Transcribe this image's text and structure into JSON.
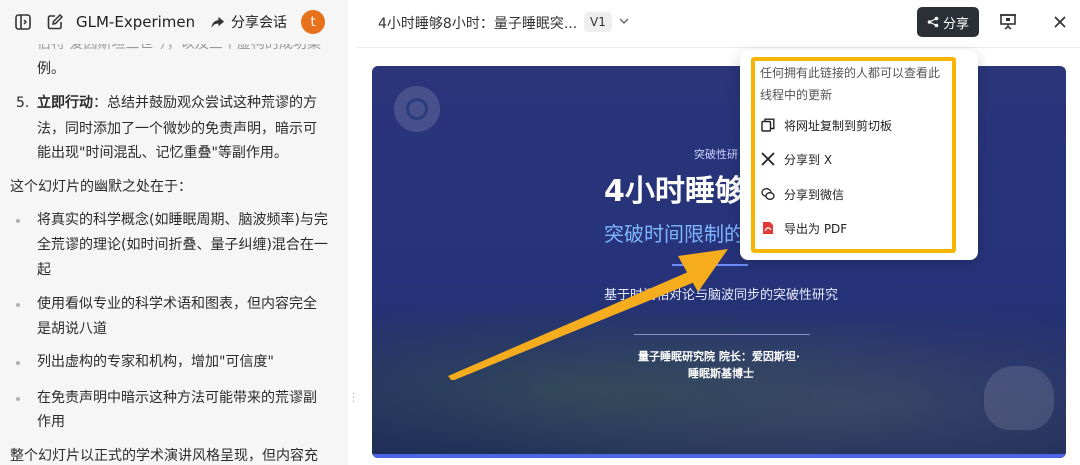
{
  "left_panel": {
    "title": "GLM-Experimen",
    "share_session_label": "分享会话",
    "avatar_letter": "t",
    "chat": {
      "top_faded_line": "伯特·爱因斯坦三世\"），以及三个虚构的成功案",
      "top_line_2": "例。",
      "item5_num": "5.",
      "item5_bold": "立即行动",
      "item5_line1_rest": "：总结并鼓励观众尝试这种荒谬的方",
      "item5_line2": "法，同时添加了一个微妙的免责声明，暗示可",
      "item5_line3": "能出现\"时间混乱、记忆重叠\"等副作用。",
      "humor_intro": "这个幻灯片的幽默之处在于：",
      "bullets": [
        {
          "line1": "将真实的科学概念(如睡眠周期、脑波频率)与完",
          "line2": "全荒谬的理论(如时间折叠、量子纠缠)混合在一",
          "line3": "起"
        },
        {
          "line1": "使用看似专业的科学术语和图表，但内容完全",
          "line2": "是胡说八道"
        },
        {
          "line1": "列出虚构的专家和机构，增加\"可信度\""
        },
        {
          "line1": "在免责声明中暗示这种方法可能带来的荒谬副",
          "line2": "作用"
        }
      ],
      "bottom_line": "整个幻灯片以正式的学术演讲风格呈现，但内容充"
    }
  },
  "topbar": {
    "doc_title": "4小时睡够8小时：量子睡眠突...",
    "version": "V1",
    "share_label": "分享"
  },
  "slide": {
    "tag": "突破性研",
    "title": "4小时睡够",
    "subtitle": "突破时间限制的",
    "description": "基于时间相对论与脑波同步的突破性研究",
    "author_line1": "量子睡眠研究院 院长：爱因斯坦·",
    "author_line2": "睡眠斯基博士"
  },
  "share_menu": {
    "note": "任何拥有此链接的人都可以查看此线程中的更新",
    "items": [
      {
        "label": "将网址复制到剪切板",
        "icon": "copy-icon"
      },
      {
        "label": "分享到 X",
        "icon": "x-logo-icon"
      },
      {
        "label": "分享到微信",
        "icon": "wechat-icon"
      },
      {
        "label": "导出为 PDF",
        "icon": "pdf-icon"
      }
    ]
  },
  "colors": {
    "highlight": "#f7b500",
    "arrow": "#f5ad1e",
    "share_button": "#2b2f36",
    "slide_bg": "#2a357a",
    "subtitle": "#7fb5ff",
    "avatar": "#e8711c"
  }
}
